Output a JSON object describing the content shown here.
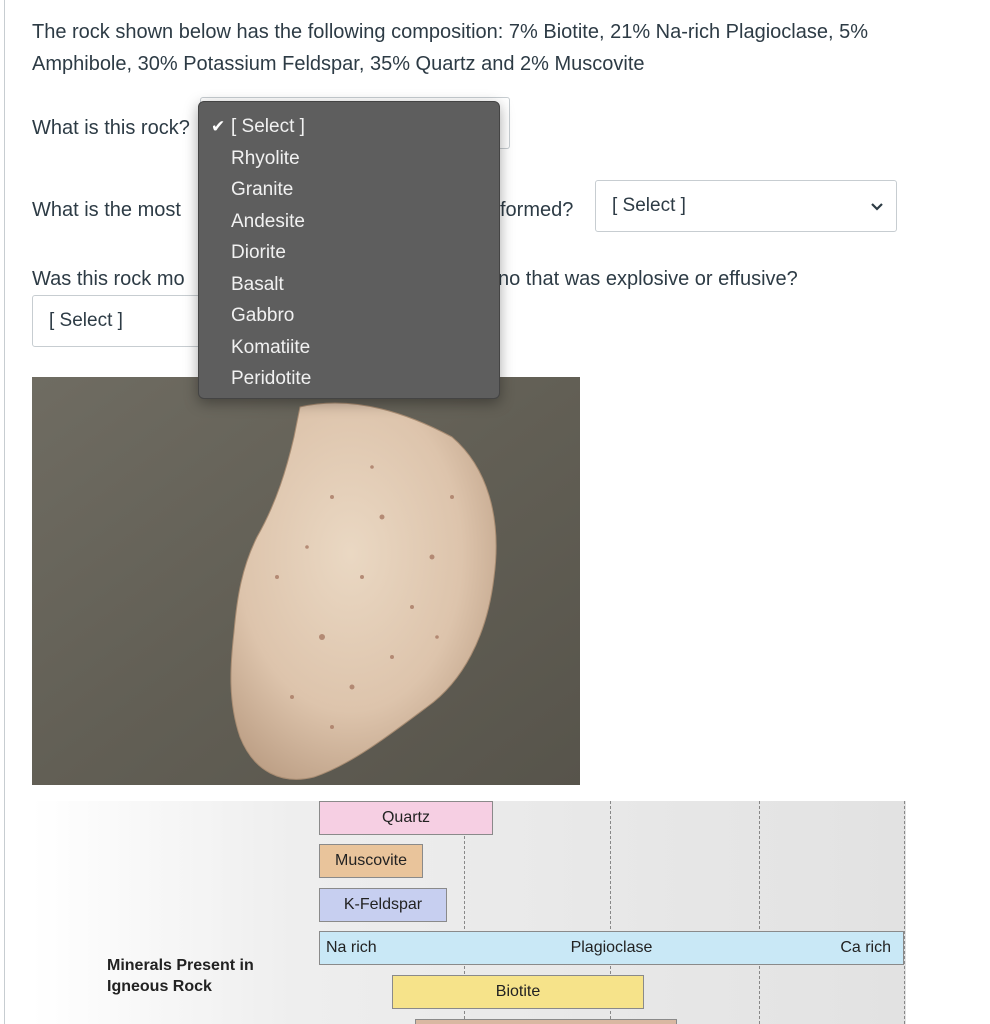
{
  "question": {
    "intro": "The rock shown below has the following composition: 7% Biotite, 21% Na-rich Plagioclase, 5% Amphibole, 30% Potassium Feldspar, 35% Quartz and 2% Muscovite",
    "q1_text": "What is this rock?",
    "q2_left": "What is the most",
    "q2_right": "formed?",
    "q3_left": "Was this rock mo",
    "q3_right": "no that was explosive or effusive?"
  },
  "selects": {
    "sel2_value": "[ Select ]",
    "sel3_value": "[ Select ]"
  },
  "dropdown": {
    "selected": "[ Select ]",
    "options": [
      "[ Select ]",
      "Rhyolite",
      "Granite",
      "Andesite",
      "Diorite",
      "Basalt",
      "Gabbro",
      "Komatiite",
      "Peridotite"
    ]
  },
  "chart": {
    "row_label": "Minerals Present in Igneous Rock",
    "minerals": {
      "quartz": "Quartz",
      "muscovite": "Muscovite",
      "kfeldspar": "K-Feldspar",
      "plagioclase": "Plagioclase",
      "na_rich": "Na rich",
      "ca_rich": "Ca rich",
      "biotite": "Biotite"
    },
    "colors": {
      "quartz": "#f6cfe3",
      "muscovite": "#e9c49b",
      "kfeldspar": "#c7cff0",
      "plagioclase": "#c9e8f6",
      "biotite": "#f6e38a",
      "amphibole": "#d9b8a2"
    }
  }
}
